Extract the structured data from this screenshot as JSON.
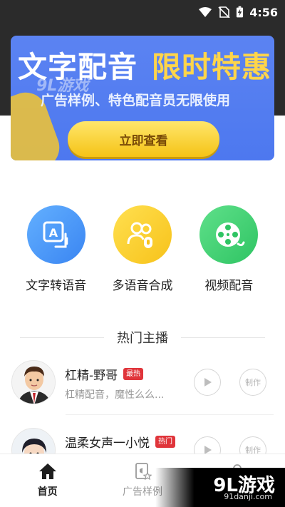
{
  "status_bar": {
    "time": "4:56"
  },
  "banner": {
    "title_white": "文字配音",
    "title_yellow": "限时特惠",
    "subtitle": "广告样例、特色配音员无限使用",
    "watermark": "9L游戏",
    "cta_label": "立即查看",
    "colors": {
      "bg": "#4d78ef",
      "accent": "#ffd54a"
    }
  },
  "features": [
    {
      "label": "文字转语音",
      "icon": "text-to-speech-icon"
    },
    {
      "label": "多语音合成",
      "icon": "multi-voice-icon"
    },
    {
      "label": "视频配音",
      "icon": "video-reel-icon"
    }
  ],
  "section": {
    "title": "热门主播"
  },
  "anchors": [
    {
      "name": "杠精-野哥",
      "badge": "最热",
      "desc": "杠精配音，魔性么么...",
      "make_label": "制作"
    },
    {
      "name": "温柔女声一小悦",
      "badge": "热门",
      "desc": "",
      "make_label": "制作"
    }
  ],
  "bottom_nav": [
    {
      "label": "首页",
      "icon": "home-icon",
      "active": true
    },
    {
      "label": "广告样例",
      "icon": "ad-sample-icon",
      "active": false
    },
    {
      "label": "",
      "icon": "profile-icon",
      "active": false
    }
  ],
  "watermark": {
    "brand": "9L游戏",
    "url": "91danji.com"
  }
}
